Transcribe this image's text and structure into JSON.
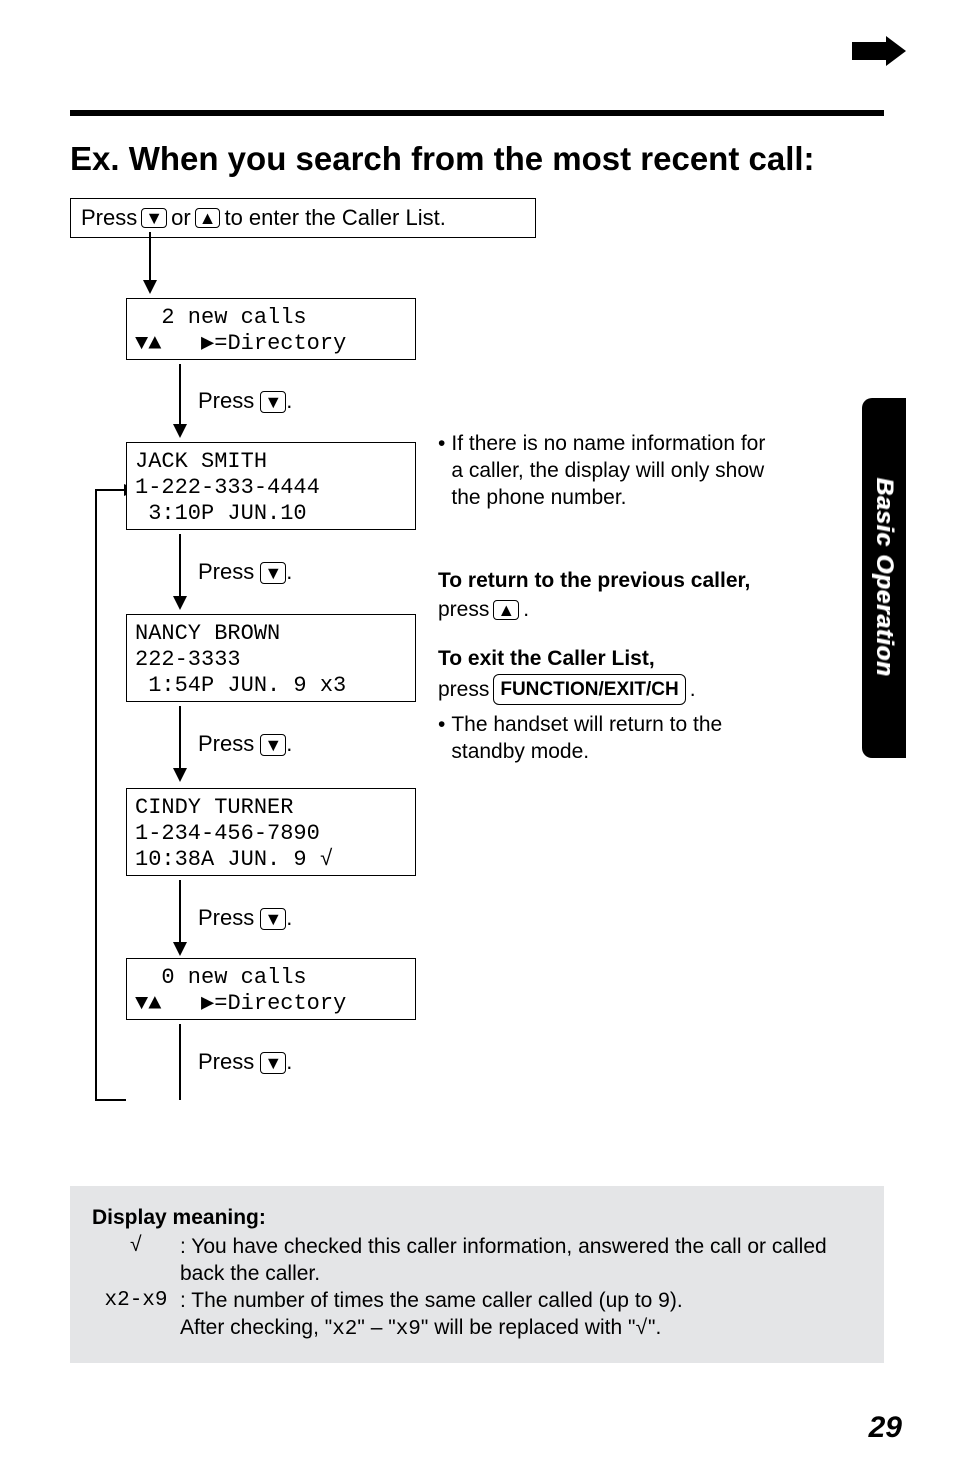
{
  "heading": "Ex. When you search from the most recent call:",
  "intro": {
    "prefix": "Press",
    "or": "or",
    "suffix": "to enter the Caller List."
  },
  "keys": {
    "down": "▼",
    "up": "▲",
    "function_exit_ch": "FUNCTION/EXIT/CH"
  },
  "press_word": "Press",
  "press_lower": "press",
  "period": ".",
  "screens": {
    "s1_line1": "  2 new calls",
    "s1_line2": "▼▲   ▶=Directory",
    "s2_line1": "JACK SMITH",
    "s2_line2": "1-222-333-4444",
    "s2_line3": " 3:10P JUN.10",
    "s3_line1": "NANCY BROWN",
    "s3_line2": "222-3333",
    "s3_line3": " 1:54P JUN. 9 x3",
    "s4_line1": "CINDY TURNER",
    "s4_line2": "1-234-456-7890",
    "s4_line3": "10:38A JUN. 9 √",
    "s5_line1": "  0 new calls",
    "s5_line2": "▼▲   ▶=Directory"
  },
  "notes": {
    "no_name": "If there is no name information for a caller, the display will only show the phone number.",
    "return_head": "To return to the previous caller,",
    "exit_head": "To exit the Caller List,",
    "standby": "The handset will return to the standby mode."
  },
  "meaning": {
    "title": "Display meaning:",
    "check_sym": "√",
    "check_desc": ": You have checked this caller information, answered the call or called back the caller.",
    "x_sym": "x2-x9",
    "x_desc_1": ": The number of times the same caller called (up to 9).",
    "x_desc_2a": "After checking, \"",
    "x_desc_2b": "x2",
    "x_desc_2c": "\" – \"",
    "x_desc_2d": "x9",
    "x_desc_2e": "\" will be replaced with \"",
    "x_desc_2f": "√",
    "x_desc_2g": "\"."
  },
  "side_tab": "Basic Operation",
  "page_number": "29"
}
